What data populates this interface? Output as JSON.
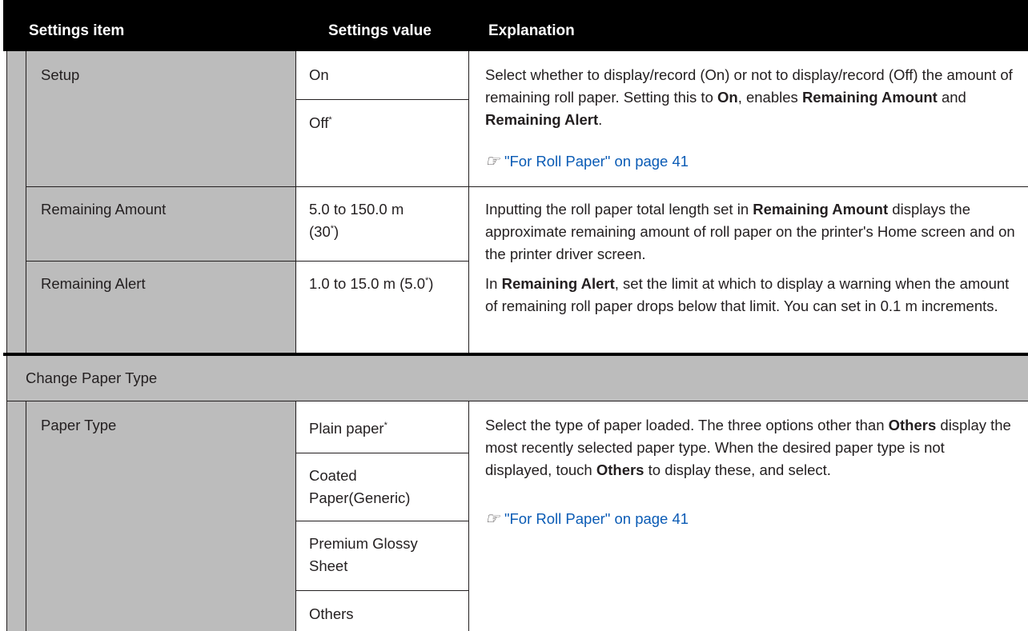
{
  "header": {
    "col_item": "Settings item",
    "col_value": "Settings value",
    "col_explanation": "Explanation"
  },
  "roll_section": {
    "setup": {
      "label": "Setup",
      "values": [
        "On",
        "Off"
      ],
      "default_marker": "*",
      "expl_1": "Select whether to display/record (On) or not to display/record (Off) the amount of remaining roll paper. Setting this to ",
      "expl_on": "On",
      "expl_2": ", enables ",
      "expl_rem_amount": "Remaining Amount",
      "expl_and": " and ",
      "expl_rem_alert": "Remaining Alert",
      "expl_end": ".",
      "link": "\"For Roll Paper\" on page 41"
    },
    "remaining_amount": {
      "label": "Remaining Amount",
      "value_1": "5.0 to 150.0 m",
      "value_2a": "(30",
      "value_2b": ")",
      "expl_1": "Inputting the roll paper total length set in ",
      "expl_bold": "Remaining Amount",
      "expl_2": " displays the approximate remaining amount of roll paper on the printer's Home screen and on the printer driver screen."
    },
    "remaining_alert": {
      "label": "Remaining Alert",
      "value_a": "1.0 to 15.0 m (5.0",
      "value_b": ")",
      "expl_1": "In ",
      "expl_bold": "Remaining Alert",
      "expl_2": ", set the limit at which to display a warning when the amount of remaining roll paper drops below that limit. You can set in 0.1 m increments."
    }
  },
  "change_paper_type": {
    "title": "Change Paper Type",
    "paper_type": {
      "label": "Paper Type",
      "values": [
        "Plain paper",
        "Coated Paper(Generic)",
        "Premium Glossy Sheet",
        "Others"
      ],
      "expl_1": "Select the type of paper loaded. The three options other than ",
      "expl_others": "Others",
      "expl_2": " display the most recently selected paper type. When the desired paper type is not displayed, touch ",
      "expl_others2": "Others",
      "expl_3": " to display these, and select.",
      "link": "\"For Roll Paper\" on page 41"
    }
  },
  "colors": {
    "header_bg": "#000000",
    "gray_bg": "#bcbcbc",
    "link": "#0a5bb5"
  },
  "icons": {
    "link_icon": "pointing-hand-icon"
  }
}
